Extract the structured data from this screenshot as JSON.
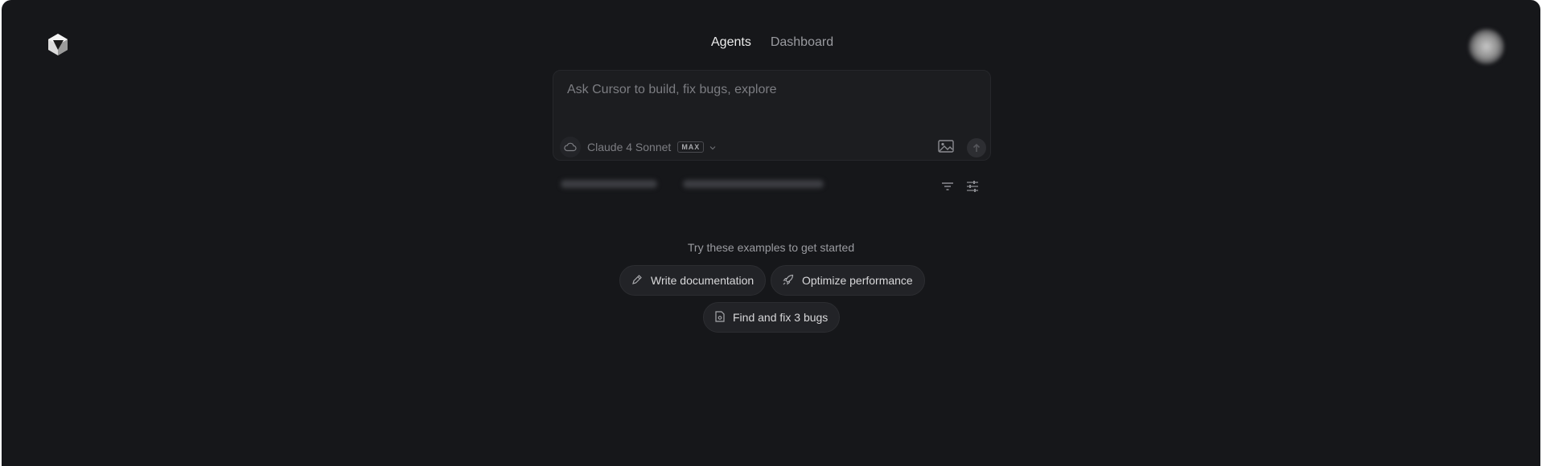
{
  "nav": {
    "tabs": [
      {
        "label": "Agents",
        "active": true
      },
      {
        "label": "Dashboard",
        "active": false
      }
    ]
  },
  "composer": {
    "placeholder": "Ask Cursor to build, fix bugs, explore",
    "model": "Claude 4 Sonnet",
    "model_badge": "MAX",
    "icons": [
      "cloud-icon",
      "chevron-down-icon",
      "image-icon",
      "send-icon"
    ]
  },
  "toolbar_icons": [
    "filter-icon",
    "sliders-icon"
  ],
  "examples": {
    "label": "Try these examples to get started",
    "chips": [
      {
        "label": "Write documentation",
        "icon": "pen-icon"
      },
      {
        "label": "Optimize performance",
        "icon": "rocket-icon"
      },
      {
        "label": "Find and fix 3 bugs",
        "icon": "bug-file-icon"
      }
    ]
  },
  "colors": {
    "background": "#16171a",
    "panel": "#1c1d20",
    "chip": "#222327",
    "text_primary": "#ececec",
    "text_muted": "#9a9ba0"
  }
}
